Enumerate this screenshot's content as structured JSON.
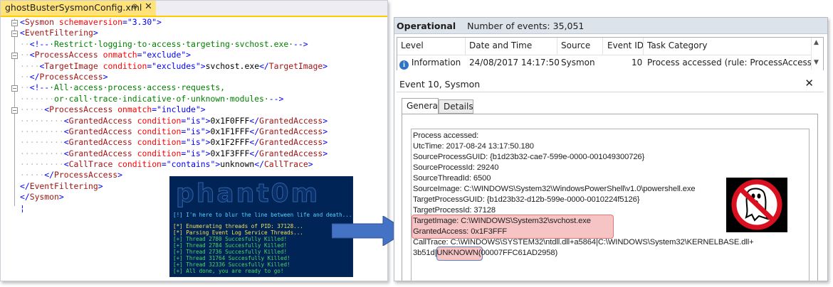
{
  "editor": {
    "tab_title": "ghostBusterSysmonConfig.xml",
    "pin_glyph": "⊕",
    "close_glyph": "✕",
    "lines": [
      {
        "dots": "",
        "parts": [
          [
            "b",
            "<"
          ],
          [
            "t",
            "Sysmon"
          ],
          [
            "x",
            " "
          ],
          [
            "a",
            "schemaversion"
          ],
          [
            "b",
            "=\""
          ],
          [
            "x",
            ""
          ],
          [
            "b",
            "3.30"
          ],
          [
            "b",
            "\">"
          ]
        ]
      },
      {
        "dots": "",
        "parts": [
          [
            "b",
            "<"
          ],
          [
            "t",
            "EventFiltering"
          ],
          [
            "b",
            ">"
          ]
        ]
      },
      {
        "dots": "··",
        "parts": [
          [
            "b",
            "<!--"
          ],
          [
            "c",
            "·Restrict·logging·to·access·targeting·svchost.exe·"
          ],
          [
            "b",
            "-->"
          ]
        ]
      },
      {
        "dots": "··",
        "parts": [
          [
            "b",
            "<"
          ],
          [
            "t",
            "ProcessAccess"
          ],
          [
            "x",
            " "
          ],
          [
            "a",
            "onmatch"
          ],
          [
            "b",
            "=\"exclude\">"
          ]
        ]
      },
      {
        "dots": "····",
        "parts": [
          [
            "b",
            "<"
          ],
          [
            "t",
            "TargetImage"
          ],
          [
            "x",
            " "
          ],
          [
            "a",
            "condition"
          ],
          [
            "b",
            "=\"excludes\">"
          ],
          [
            "x",
            "svchost.exe"
          ],
          [
            "b",
            "</"
          ],
          [
            "t",
            "TargetImage"
          ],
          [
            "b",
            ">"
          ]
        ]
      },
      {
        "dots": "··",
        "parts": [
          [
            "b",
            "</"
          ],
          [
            "t",
            "ProcessAccess"
          ],
          [
            "b",
            ">"
          ]
        ]
      },
      {
        "dots": "··",
        "parts": [
          [
            "b",
            "<!--"
          ],
          [
            "c",
            "·All·access·process·access·requests,"
          ]
        ]
      },
      {
        "dots": "·······",
        "parts": [
          [
            "c",
            "or·call·trace·indicative·of·unknown·modules·"
          ],
          [
            "b",
            "-->"
          ]
        ]
      },
      {
        "dots": "·····",
        "parts": [
          [
            "b",
            "<"
          ],
          [
            "t",
            "ProcessAccess"
          ],
          [
            "x",
            " "
          ],
          [
            "a",
            "onmatch"
          ],
          [
            "b",
            "=\"include\">"
          ]
        ]
      },
      {
        "dots": "·········",
        "parts": [
          [
            "b",
            "<"
          ],
          [
            "t",
            "GrantedAccess"
          ],
          [
            "x",
            " "
          ],
          [
            "a",
            "condition"
          ],
          [
            "b",
            "=\"is\">"
          ],
          [
            "x",
            "0x1F0FFF"
          ],
          [
            "b",
            "</"
          ],
          [
            "t",
            "GrantedAccess"
          ],
          [
            "b",
            ">"
          ]
        ]
      },
      {
        "dots": "·········",
        "parts": [
          [
            "b",
            "<"
          ],
          [
            "t",
            "GrantedAccess"
          ],
          [
            "x",
            " "
          ],
          [
            "a",
            "condition"
          ],
          [
            "b",
            "=\"is\">"
          ],
          [
            "x",
            "0x1F1FFF"
          ],
          [
            "b",
            "</"
          ],
          [
            "t",
            "GrantedAccess"
          ],
          [
            "b",
            ">"
          ]
        ]
      },
      {
        "dots": "·········",
        "parts": [
          [
            "b",
            "<"
          ],
          [
            "t",
            "GrantedAccess"
          ],
          [
            "x",
            " "
          ],
          [
            "a",
            "condition"
          ],
          [
            "b",
            "=\"is\">"
          ],
          [
            "x",
            "0x1F2FFF"
          ],
          [
            "b",
            "</"
          ],
          [
            "t",
            "GrantedAccess"
          ],
          [
            "b",
            ">"
          ]
        ]
      },
      {
        "dots": "·········",
        "parts": [
          [
            "b",
            "<"
          ],
          [
            "t",
            "GrantedAccess"
          ],
          [
            "x",
            " "
          ],
          [
            "a",
            "condition"
          ],
          [
            "b",
            "=\"is\">"
          ],
          [
            "x",
            "0x1F3FFF"
          ],
          [
            "b",
            "</"
          ],
          [
            "t",
            "GrantedAccess"
          ],
          [
            "b",
            ">"
          ]
        ]
      },
      {
        "dots": "·········",
        "parts": [
          [
            "b",
            "<"
          ],
          [
            "t",
            "CallTrace"
          ],
          [
            "x",
            " "
          ],
          [
            "a",
            "condition"
          ],
          [
            "b",
            "=\"contains\">"
          ],
          [
            "x",
            "unknown"
          ],
          [
            "b",
            "</"
          ],
          [
            "t",
            "CallTrace"
          ],
          [
            "b",
            ">"
          ]
        ]
      },
      {
        "dots": "·····",
        "parts": [
          [
            "b",
            "</"
          ],
          [
            "t",
            "ProcessAccess"
          ],
          [
            "b",
            ">"
          ]
        ]
      },
      {
        "dots": "",
        "parts": [
          [
            "b",
            "</"
          ],
          [
            "t",
            "EventFiltering"
          ],
          [
            "b",
            ">"
          ]
        ]
      },
      {
        "dots": "",
        "parts": [
          [
            "b",
            "</"
          ],
          [
            "t",
            "Sysmon"
          ],
          [
            "b",
            ">"
          ]
        ]
      },
      {
        "dots": "",
        "parts": [
          [
            "b",
            "¦"
          ]
        ]
      }
    ]
  },
  "console": {
    "logo": "phant0m",
    "line1": "[!] I'm here to blur the line between life and death...",
    "line2": "[*] Enumerating threads of PID: 37128...",
    "line3": "[*] Parsing Event Log Service Threads...",
    "killed": [
      "[+] Thread 2780 Succesfully Killed!",
      "[+] Thread 2784 Succesfully Killed!",
      "[+] Thread 2736 Succesfully Killed!",
      "[+] Thread 31764 Succesfully Killed!",
      "[+] Thread 32336 Succesfully Killed!"
    ],
    "done": "[+] All done, you are ready to go!"
  },
  "viewer": {
    "log_name": "Operational",
    "event_count": "Number of events: 35,051",
    "columns": [
      "Level",
      "Date and Time",
      "Source",
      "Event ID",
      "Task Category"
    ],
    "row": {
      "level": "Information",
      "datetime": "24/08/2017 14:17:50",
      "source": "Sysmon",
      "event_id": "10",
      "task_category": "Process accessed (rule: ProcessAccess)"
    },
    "detail_title": "Event 10, Sysmon",
    "close_glyph": "✕",
    "tabs": [
      "General",
      "Details"
    ],
    "detail_lines": [
      "Process accessed:",
      "UtcTime: 2017-08-24 13:17:50.180",
      "SourceProcessGUID: {b1d23b32-cae7-599e-0000-001049300726}",
      "SourceProcessId: 29240",
      "SourceThreadId: 6500",
      "SourceImage: C:\\WINDOWS\\System32\\WindowsPowerShell\\v1.0\\powershell.exe",
      "TargetProcessGUID: {b1d23b32-d12b-599e-0000-0010224f5126}",
      "TargetProcessId: 37128",
      "TargetImage: C:\\WINDOWS\\System32\\svchost.exe",
      "GrantedAccess: 0x1F3FFF",
      "CallTrace: C:\\WINDOWS\\SYSTEM32\\ntdll.dll+a5864|C:\\WINDOWS\\System32\\KERNELBASE.dll+",
      "3b51d|UNKNOWN(00007FFC61AD2958)"
    ]
  },
  "colors": {
    "tab_accent": "#ffcc00",
    "console_bg": "#012456",
    "highlight": "#f6c4c4",
    "arrow": "#4472c4"
  }
}
